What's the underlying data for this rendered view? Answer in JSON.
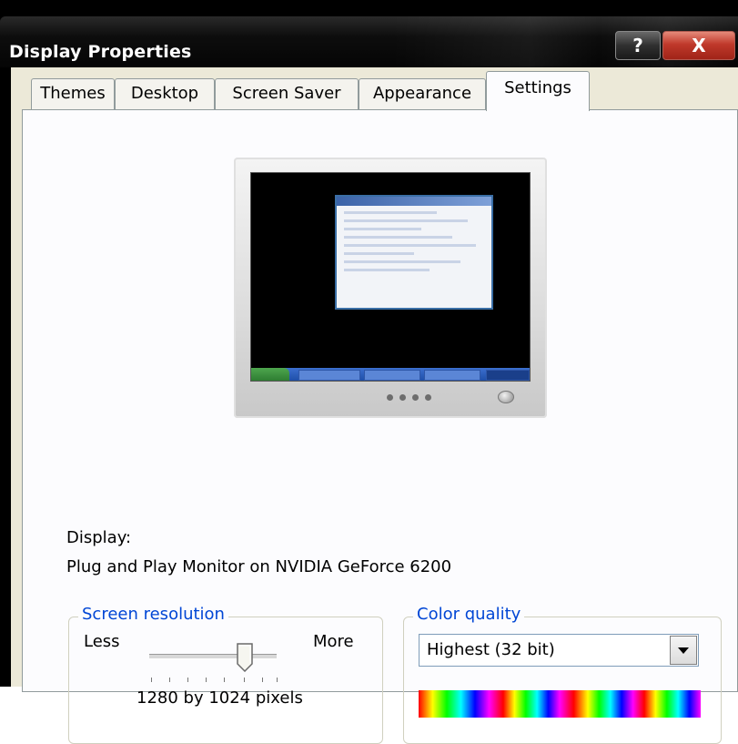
{
  "window": {
    "title": "Display Properties",
    "help_label": "?",
    "close_label": "X"
  },
  "tabs": [
    {
      "label": "Themes"
    },
    {
      "label": "Desktop"
    },
    {
      "label": "Screen Saver"
    },
    {
      "label": "Appearance"
    },
    {
      "label": "Settings",
      "active": true
    }
  ],
  "settings": {
    "display_label": "Display:",
    "display_value": "Plug and Play Monitor on NVIDIA GeForce 6200",
    "resolution": {
      "legend": "Screen resolution",
      "less_label": "Less",
      "more_label": "More",
      "value_text": "1280 by 1024 pixels",
      "slider_level": 0.75
    },
    "color": {
      "legend": "Color quality",
      "selected": "Highest (32 bit)"
    }
  },
  "colors": {
    "title_bar": "#0d0d0d",
    "close_button": "#c0392b",
    "dialog_face": "#ece9d8",
    "group_legend": "#0046d5"
  },
  "icons": {
    "help": "help-button",
    "close": "close-x-icon",
    "dropdown": "chevron-down-icon",
    "monitor": "monitor-preview-icon"
  }
}
